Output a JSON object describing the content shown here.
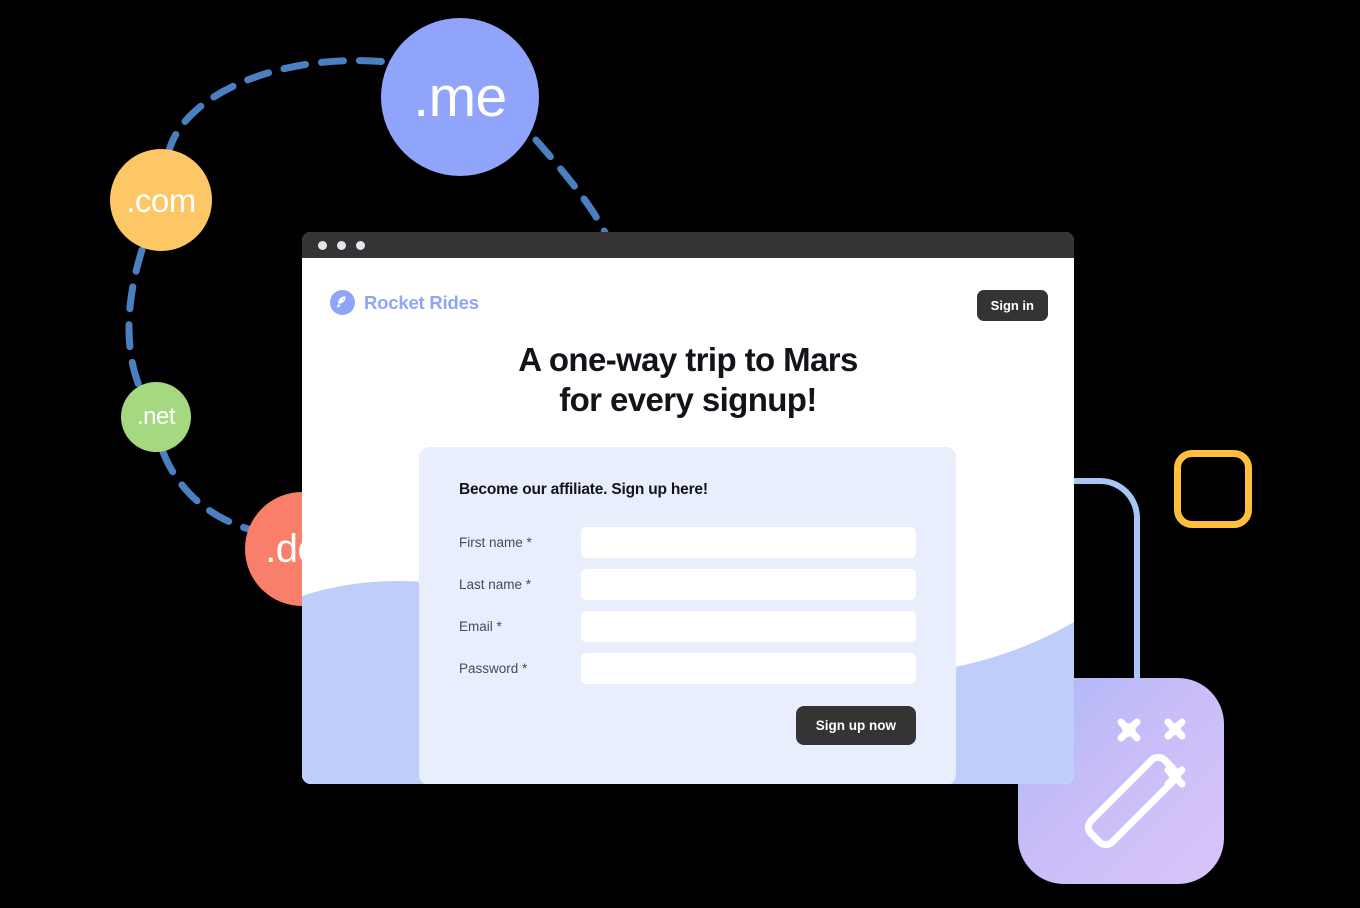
{
  "bubbles": [
    {
      "id": "me",
      "label": ".me",
      "color": "#8fa4fa"
    },
    {
      "id": "com",
      "label": ".com",
      "color": "#fdc765"
    },
    {
      "id": "net",
      "label": ".net",
      "color": "#a5d981"
    },
    {
      "id": "dev",
      "label": ".dev",
      "color": "#fa7f6b"
    }
  ],
  "browser": {
    "brand": {
      "name": "Rocket Rides",
      "icon": "rocket-icon",
      "color": "#8fa4fa"
    },
    "signin_label": "Sign in",
    "headline_line1": "A one-way trip to Mars",
    "headline_line2": "for every signup!",
    "form": {
      "title": "Become our affiliate. Sign up here!",
      "fields": [
        {
          "label": "First name *",
          "value": "",
          "placeholder": "",
          "name": "first-name"
        },
        {
          "label": "Last name *",
          "value": "",
          "placeholder": "",
          "name": "last-name"
        },
        {
          "label": "Email *",
          "value": "",
          "placeholder": "",
          "name": "email"
        },
        {
          "label": "Password *",
          "value": "",
          "placeholder": "",
          "name": "password"
        }
      ],
      "submit_label": "Sign up now"
    }
  },
  "decor": {
    "orange_square_color": "#ffbe3d",
    "blue_curve_color": "#a8c6f5",
    "magic_tile_icon": "magic-wand-icon",
    "connector_color": "#4a7fc1",
    "wave_color": "#bfcdfb"
  }
}
